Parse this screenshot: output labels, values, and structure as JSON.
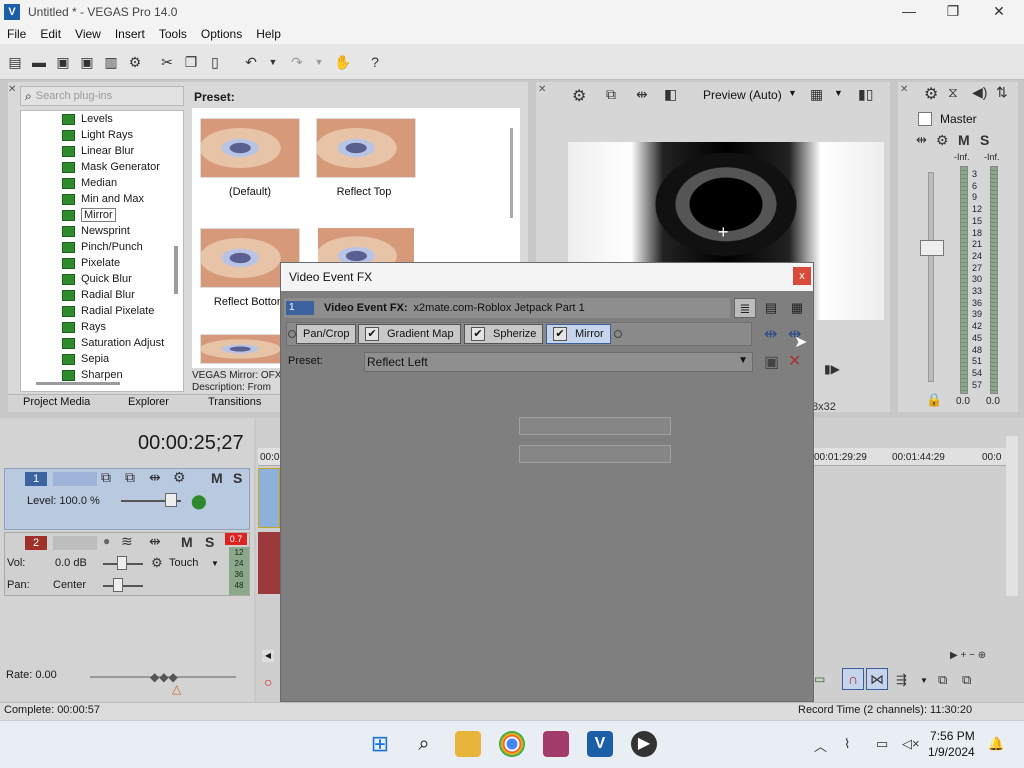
{
  "window": {
    "title": "Untitled * - VEGAS Pro 14.0",
    "logo_letter": "V",
    "minimize": "—",
    "maximize": "❐",
    "close": "✕"
  },
  "menu": [
    "File",
    "Edit",
    "View",
    "Insert",
    "Tools",
    "Options",
    "Help"
  ],
  "plugins": {
    "search_placeholder": "Search plug-ins",
    "items": [
      "Levels",
      "Light Rays",
      "Linear Blur",
      "Mask Generator",
      "Median",
      "Min and Max",
      "Mirror",
      "Newsprint",
      "Pinch/Punch",
      "Pixelate",
      "Quick Blur",
      "Radial Blur",
      "Radial Pixelate",
      "Rays",
      "Saturation Adjust",
      "Sepia",
      "Sharpen"
    ],
    "selected": "Mirror",
    "preset_heading": "Preset:",
    "presets": [
      "(Default)",
      "Reflect Top",
      "Reflect Bottom",
      ""
    ],
    "description_line1": "VEGAS Mirror: OFX",
    "description_line2": "Description: From"
  },
  "bottom_tabs": [
    "Project Media",
    "Explorer",
    "Transitions"
  ],
  "preview": {
    "quality": "Preview (Auto)",
    "frame_size": "8x32"
  },
  "master": {
    "label": "Master",
    "m": "M",
    "s": "S",
    "inf_left": "-Inf.",
    "inf_right": "-Inf.",
    "scale": [
      "3",
      "6",
      "9",
      "12",
      "15",
      "18",
      "21",
      "24",
      "27",
      "30",
      "33",
      "36",
      "39",
      "42",
      "45",
      "48",
      "51",
      "54",
      "57"
    ],
    "bottom_left": "0.0",
    "bottom_right": "0.0"
  },
  "timeline": {
    "timecode": "00:00:25;27",
    "track1": {
      "num": "1",
      "level": "Level: 100.0 %",
      "m": "M",
      "s": "S"
    },
    "track2": {
      "num": "2",
      "vol_label": "Vol:",
      "vol": "0.0 dB",
      "pan_label": "Pan:",
      "pan": "Center",
      "touch": "Touch",
      "m": "M",
      "s": "S",
      "peak": "0.7",
      "meter_vals": [
        "12",
        "24",
        "36",
        "48"
      ]
    },
    "ruler_labels": [
      "00:00",
      "00:01:29:29",
      "00:01:44:29",
      "00:0"
    ],
    "rate": "Rate: 0.00"
  },
  "status": {
    "left": "Complete: 00:00:57",
    "right": "Record Time (2 channels): 11:30:20"
  },
  "dialog": {
    "title": "Video Event FX",
    "close": "x",
    "header_num": "1",
    "header_label": "Video Event FX:",
    "header_value": "x2mate.com-Roblox Jetpack Part 1",
    "chain": [
      "Pan/Crop",
      "Gradient Map",
      "Spherize",
      "Mirror"
    ],
    "preset_label": "Preset:",
    "preset_value": "Reflect Left"
  },
  "taskbar": {
    "time": "7:56 PM",
    "date": "1/9/2024"
  },
  "colors": {
    "accent": "#3a5f99",
    "close_red": "#d94a3a",
    "fx_green": "#2e8b2e"
  }
}
